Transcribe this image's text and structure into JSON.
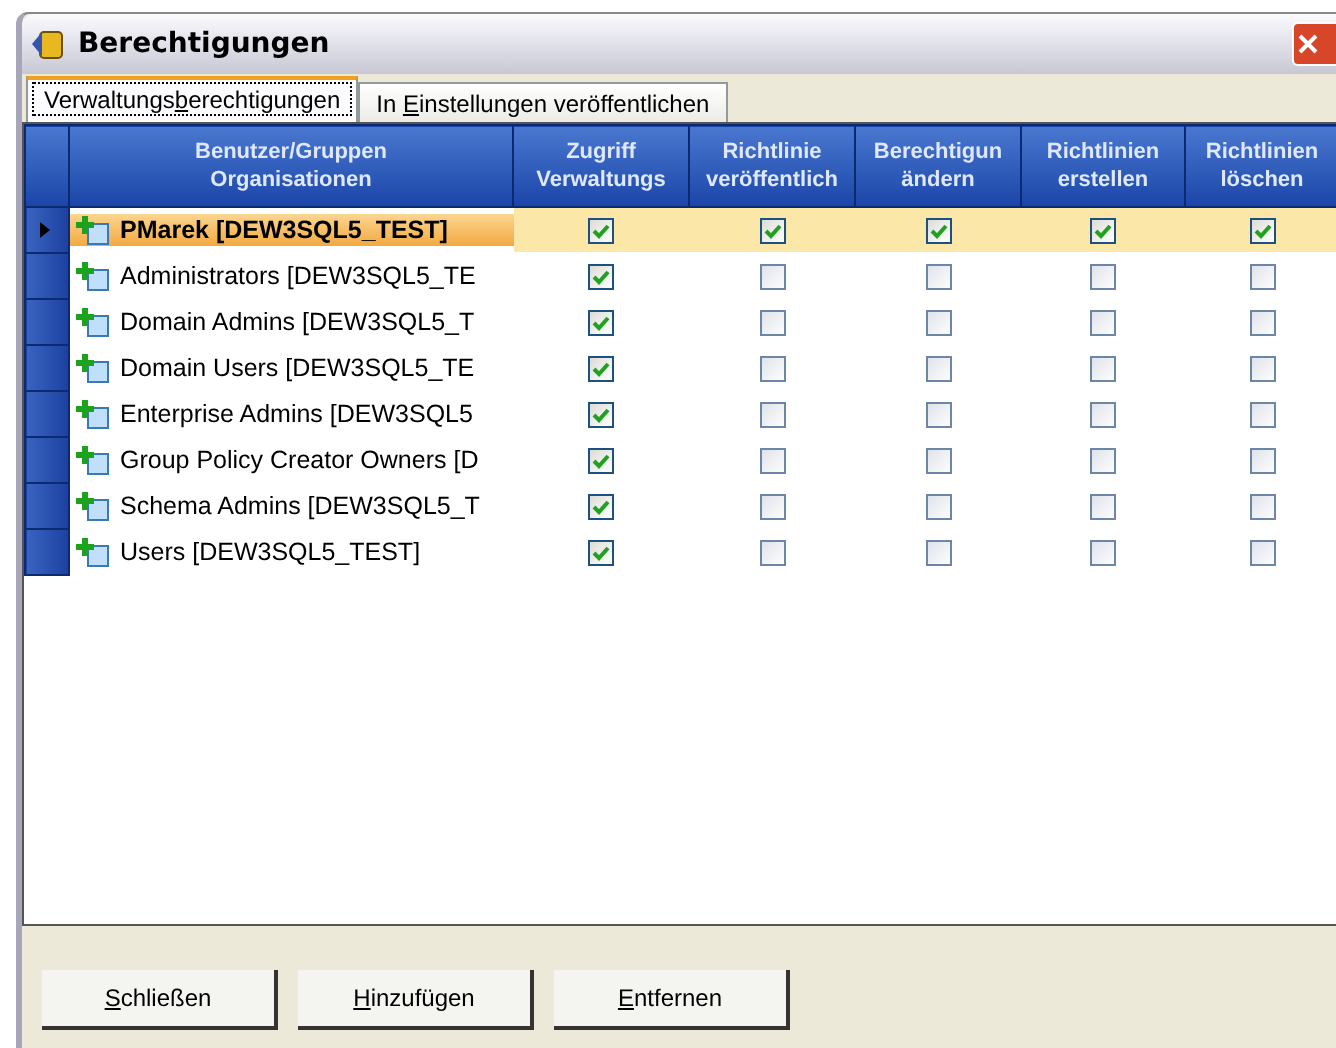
{
  "window": {
    "title": "Berechtigungen"
  },
  "tabs": [
    {
      "before": "Verwaltungs",
      "key": "b",
      "after": "erechtigungen",
      "selected": true
    },
    {
      "before": "In ",
      "key": "E",
      "after": "instellungen veröffentlichen",
      "selected": false
    }
  ],
  "table": {
    "columns": [
      {
        "lines": [
          "Benutzer/Gruppen",
          "Organisationen"
        ]
      },
      {
        "lines": [
          "Zugriff",
          "Verwaltungs"
        ]
      },
      {
        "lines": [
          "Richtlinie",
          "veröffentlich"
        ]
      },
      {
        "lines": [
          "Berechtigun",
          "ändern"
        ]
      },
      {
        "lines": [
          "Richtlinien",
          "erstellen"
        ]
      },
      {
        "lines": [
          "Richtlinien",
          "löschen"
        ]
      }
    ],
    "rows": [
      {
        "name": "PMarek [DEW3SQL5_TEST]",
        "selected": true,
        "checks": [
          true,
          true,
          true,
          true,
          true
        ]
      },
      {
        "name": "Administrators [DEW3SQL5_TE",
        "selected": false,
        "checks": [
          true,
          false,
          false,
          false,
          false
        ]
      },
      {
        "name": "Domain Admins [DEW3SQL5_T",
        "selected": false,
        "checks": [
          true,
          false,
          false,
          false,
          false
        ]
      },
      {
        "name": "Domain Users [DEW3SQL5_TE",
        "selected": false,
        "checks": [
          true,
          false,
          false,
          false,
          false
        ]
      },
      {
        "name": "Enterprise Admins [DEW3SQL5",
        "selected": false,
        "checks": [
          true,
          false,
          false,
          false,
          false
        ]
      },
      {
        "name": "Group Policy Creator Owners [D",
        "selected": false,
        "checks": [
          true,
          false,
          false,
          false,
          false
        ]
      },
      {
        "name": "Schema Admins [DEW3SQL5_T",
        "selected": false,
        "checks": [
          true,
          false,
          false,
          false,
          false
        ]
      },
      {
        "name": "Users [DEW3SQL5_TEST]",
        "selected": false,
        "checks": [
          true,
          false,
          false,
          false,
          false
        ]
      }
    ]
  },
  "buttons": [
    {
      "key": "S",
      "after": "chließen"
    },
    {
      "key": "H",
      "after": "inzufügen"
    },
    {
      "key": "E",
      "after": "ntfernen"
    }
  ]
}
